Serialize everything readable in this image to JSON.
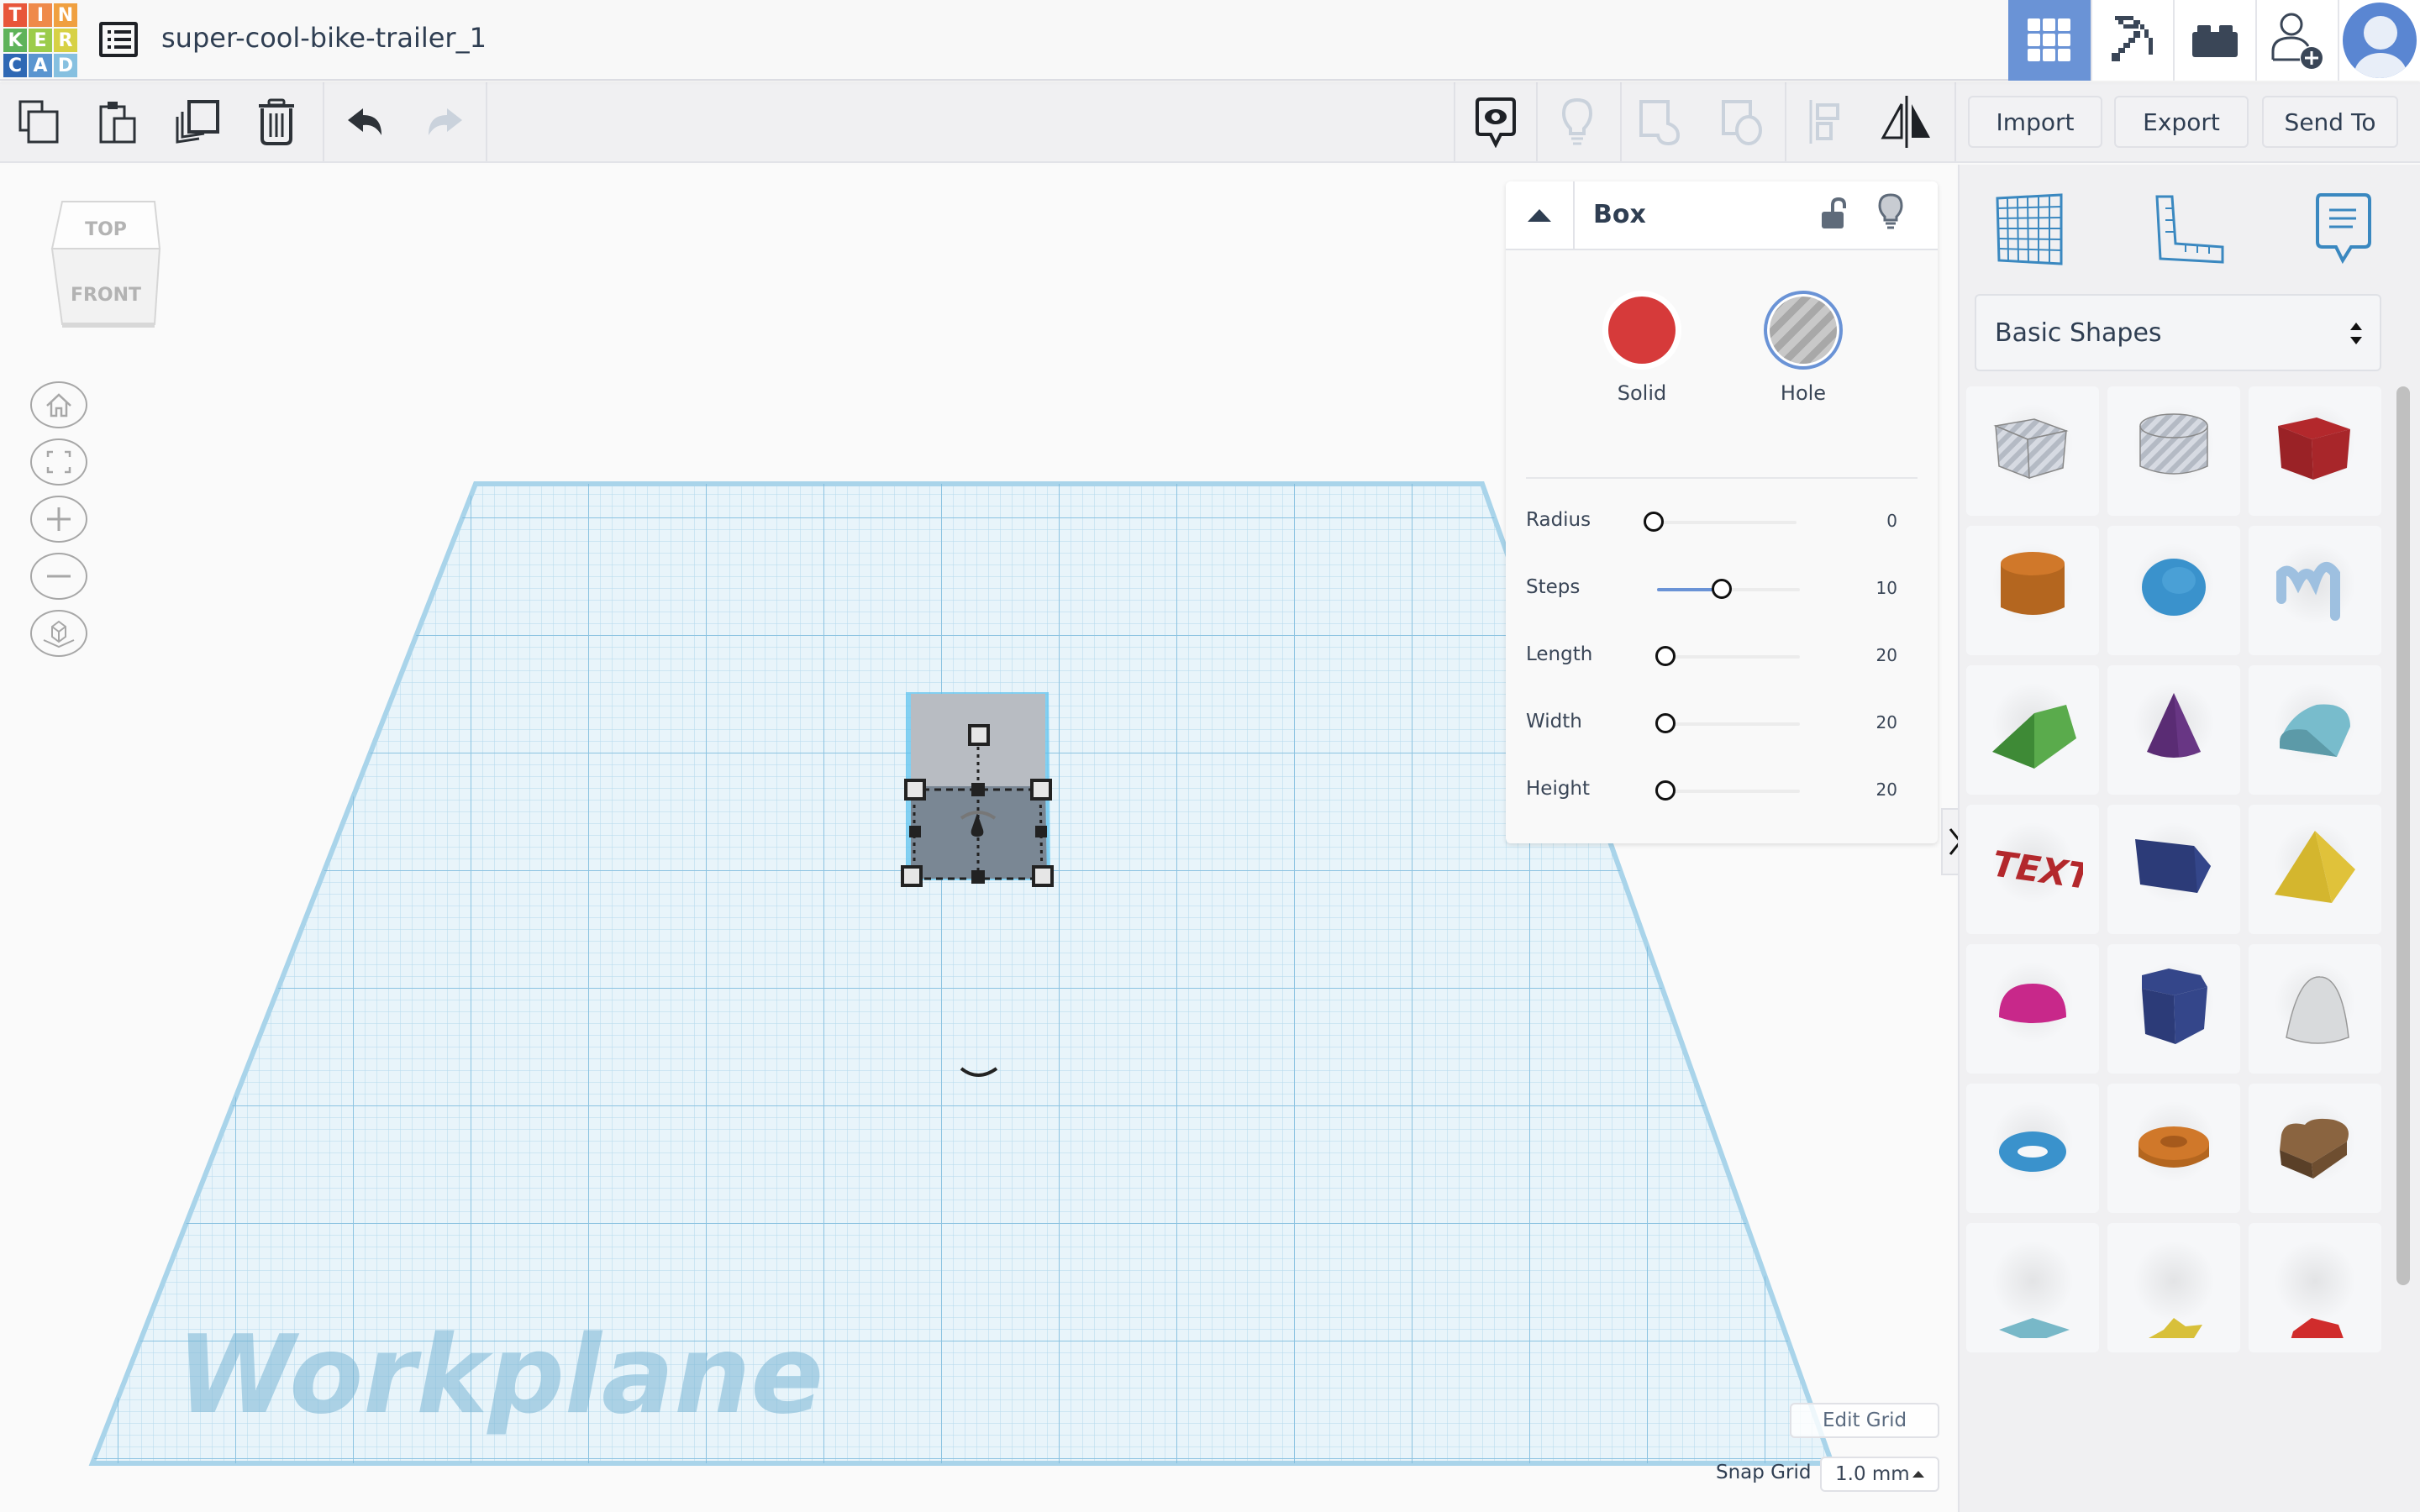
{
  "header": {
    "logo_letters": [
      "T",
      "I",
      "N",
      "K",
      "E",
      "R",
      "C",
      "A",
      "D"
    ],
    "logo_colors": [
      "#e8563a",
      "#ef8a4a",
      "#f0a040",
      "#5fb35a",
      "#9ccc4a",
      "#d7d145",
      "#2e68b4",
      "#5a95d0",
      "#86c0e0"
    ],
    "document_title": "super-cool-bike-trailer_1",
    "view_buttons": [
      {
        "name": "3d-design-view",
        "icon": "grid-icon",
        "active": true
      },
      {
        "name": "codeblocks-view",
        "icon": "pickaxe-icon",
        "active": false
      },
      {
        "name": "bricks-view",
        "icon": "brick-icon",
        "active": false
      }
    ],
    "invite_icon": "add-user-icon",
    "accent_color": "#6a93d6"
  },
  "toolbar": {
    "left_tools": [
      {
        "name": "copy",
        "icon": "copy-icon",
        "enabled": true
      },
      {
        "name": "paste",
        "icon": "paste-icon",
        "enabled": true
      },
      {
        "name": "duplicate",
        "icon": "duplicate-icon",
        "enabled": true
      },
      {
        "name": "delete",
        "icon": "trash-icon",
        "enabled": true
      },
      {
        "name": "undo",
        "icon": "undo-icon",
        "enabled": true
      },
      {
        "name": "redo",
        "icon": "redo-icon",
        "enabled": false
      }
    ],
    "right_tools": [
      {
        "name": "show-all",
        "icon": "eye-bubble-icon",
        "enabled": true
      },
      {
        "name": "hide",
        "icon": "lightbulb-icon",
        "enabled": false
      },
      {
        "name": "group",
        "icon": "group-icon",
        "enabled": false
      },
      {
        "name": "ungroup",
        "icon": "ungroup-icon",
        "enabled": false
      },
      {
        "name": "align",
        "icon": "align-icon",
        "enabled": false
      },
      {
        "name": "mirror",
        "icon": "mirror-icon",
        "enabled": true
      }
    ],
    "import_label": "Import",
    "export_label": "Export",
    "send_to_label": "Send To"
  },
  "viewport": {
    "view_cube": {
      "top_label": "TOP",
      "front_label": "FRONT"
    },
    "nav_buttons": [
      {
        "name": "home-view",
        "icon": "home-icon"
      },
      {
        "name": "fit-view",
        "icon": "fit-icon"
      },
      {
        "name": "zoom-in",
        "icon": "plus-icon"
      },
      {
        "name": "zoom-out",
        "icon": "minus-icon"
      },
      {
        "name": "projection-toggle",
        "icon": "cube-icon"
      }
    ],
    "workplane_label": "Workplane",
    "edit_grid_label": "Edit Grid",
    "snap_grid_label": "Snap Grid",
    "snap_grid_value": "1.0 mm"
  },
  "inspector": {
    "title": "Box",
    "locked": false,
    "solid_label": "Solid",
    "hole_label": "Hole",
    "solid_color": "#d63a3a",
    "selected_mode": "Hole",
    "properties": [
      {
        "label": "Radius",
        "value": "0",
        "fraction": 0.0,
        "filled": false
      },
      {
        "label": "Steps",
        "value": "10",
        "fraction": 0.45,
        "filled": true
      },
      {
        "label": "Length",
        "value": "20",
        "fraction": 0.0,
        "filled": false
      },
      {
        "label": "Width",
        "value": "20",
        "fraction": 0.0,
        "filled": false
      },
      {
        "label": "Height",
        "value": "20",
        "fraction": 0.0,
        "filled": false
      }
    ]
  },
  "right_panel": {
    "tool_icons": [
      "workplane-icon",
      "ruler-icon",
      "notes-icon"
    ],
    "library_selected": "Basic Shapes",
    "shapes": [
      {
        "name": "box-hole",
        "color": "#c3c8d0"
      },
      {
        "name": "cylinder-hole",
        "color": "#c3c8d0"
      },
      {
        "name": "box",
        "color": "#b3282c"
      },
      {
        "name": "cylinder",
        "color": "#d0782a"
      },
      {
        "name": "sphere",
        "color": "#3a92cc"
      },
      {
        "name": "scribble",
        "color": "#9ec0e0"
      },
      {
        "name": "roof",
        "color": "#5aab4c"
      },
      {
        "name": "cone",
        "color": "#6e3a8c"
      },
      {
        "name": "round-roof",
        "color": "#78bccc"
      },
      {
        "name": "text",
        "color": "#b3282c"
      },
      {
        "name": "polygon",
        "color": "#2c3b78"
      },
      {
        "name": "pyramid",
        "color": "#e0c23a"
      },
      {
        "name": "half-sphere",
        "color": "#c8288a"
      },
      {
        "name": "hexagonal-prism",
        "color": "#2c3b78"
      },
      {
        "name": "paraboloid",
        "color": "#d8dadc"
      },
      {
        "name": "torus",
        "color": "#3a92cc"
      },
      {
        "name": "tube",
        "color": "#d0782a"
      },
      {
        "name": "heart",
        "color": "#8a6440"
      },
      {
        "name": "star-six",
        "color": "#78b8c8"
      },
      {
        "name": "star",
        "color": "#d8c03a"
      },
      {
        "name": "icosahedron",
        "color": "#d02c2c"
      }
    ]
  }
}
